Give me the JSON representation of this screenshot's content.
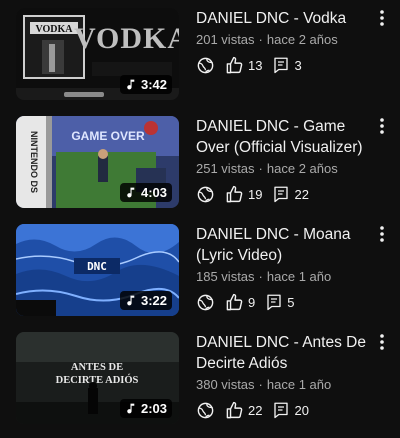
{
  "videos": [
    {
      "title": "DANIEL DNC - Vodka",
      "views": "201 vistas",
      "age": "hace 2 años",
      "likes": "13",
      "comments": "3",
      "duration": "3:42",
      "thumb_text": "VODKA"
    },
    {
      "title": "DANIEL DNC - Game Over (Official Visualizer)",
      "views": "251 vistas",
      "age": "hace 2 años",
      "likes": "19",
      "comments": "22",
      "duration": "4:03",
      "thumb_text": "GAME OVER"
    },
    {
      "title": "DANIEL DNC - Moana (Lyric Video)",
      "views": "185 vistas",
      "age": "hace 1 año",
      "likes": "9",
      "comments": "5",
      "duration": "3:22",
      "thumb_text": "DNC"
    },
    {
      "title": "DANIEL DNC - Antes De Decirte Adiós",
      "views": "380 vistas",
      "age": "hace 1 año",
      "likes": "22",
      "comments": "20",
      "duration": "2:03",
      "thumb_text": "ANTES DE DECIRTE ADIÓS"
    }
  ],
  "meta_separator": "·",
  "colors": {
    "background": "#0f0f0f",
    "text_primary": "#f1f1f1",
    "text_secondary": "#aaaaaa"
  }
}
